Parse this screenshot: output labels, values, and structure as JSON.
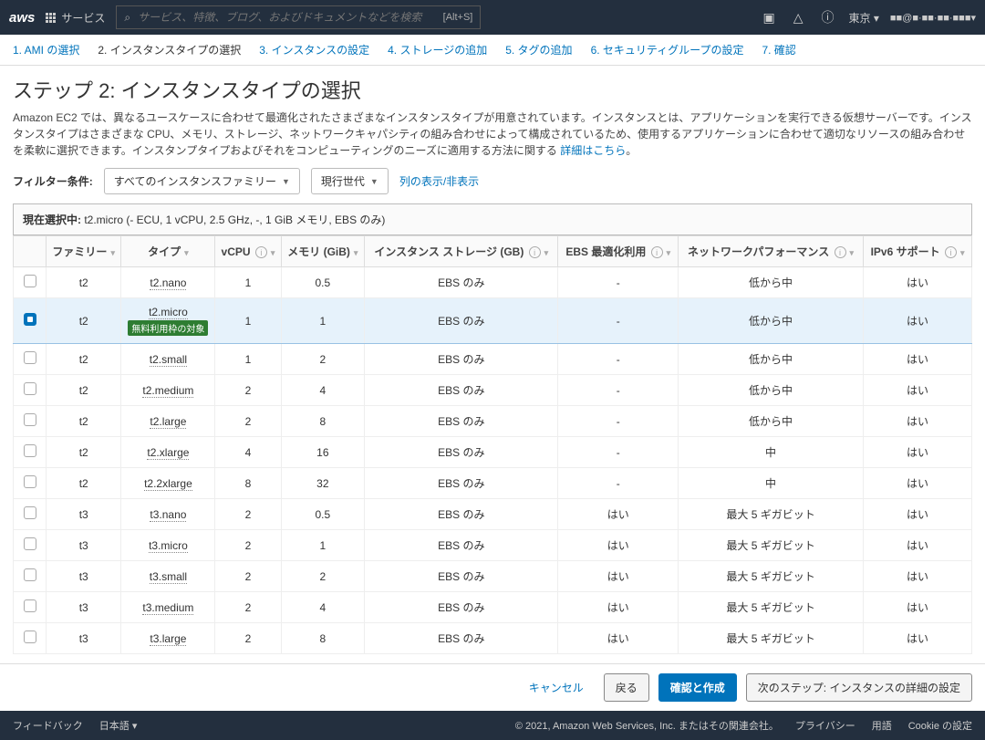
{
  "topbar": {
    "services": "サービス",
    "search_placeholder": "サービス、特徴、ブログ、およびドキュメントなどを検索",
    "search_shortcut": "[Alt+S]",
    "region": "東京 ▾",
    "user": "■■@■·■■·■■·■■■▾"
  },
  "wizard": [
    "1. AMI の選択",
    "2. インスタンスタイプの選択",
    "3. インスタンスの設定",
    "4. ストレージの追加",
    "5. タグの追加",
    "6. セキュリティグループの設定",
    "7. 確認"
  ],
  "heading": "ステップ 2: インスタンスタイプの選択",
  "description": "Amazon EC2 では、異なるユースケースに合わせて最適化されたさまざまなインスタンスタイプが用意されています。インスタンスとは、アプリケーションを実行できる仮想サーバーです。インスタンスタイプはさまざまな CPU、メモリ、ストレージ、ネットワークキャパシティの組み合わせによって構成されているため、使用するアプリケーションに合わせて適切なリソースの組み合わせを柔軟に選択できます。インスタンプタイプおよびそれをコンピューティングのニーズに適用する方法に関する ",
  "desc_link": "詳細はこちら",
  "filter": {
    "label": "フィルター条件:",
    "family": "すべてのインスタンスファミリー",
    "gen": "現行世代",
    "columns_link": "列の表示/非表示"
  },
  "selected_bar": {
    "prefix": "現在選択中: ",
    "text": "t2.micro (- ECU, 1 vCPU, 2.5 GHz, -, 1 GiB メモリ, EBS のみ)"
  },
  "columns": {
    "family": "ファミリー",
    "type": "タイプ",
    "vcpu": "vCPU",
    "memory": "メモリ (GiB)",
    "storage": "インスタンス ストレージ (GB)",
    "ebs": "EBS 最適化利用",
    "network": "ネットワークパフォーマンス",
    "ipv6": "IPv6 サポート"
  },
  "free_tier_label": "無料利用枠の対象",
  "rows": [
    {
      "sel": false,
      "family": "t2",
      "type": "t2.nano",
      "vcpu": "1",
      "mem": "0.5",
      "storage": "EBS のみ",
      "ebs": "-",
      "net": "低から中",
      "ipv6": "はい",
      "free": false
    },
    {
      "sel": true,
      "family": "t2",
      "type": "t2.micro",
      "vcpu": "1",
      "mem": "1",
      "storage": "EBS のみ",
      "ebs": "-",
      "net": "低から中",
      "ipv6": "はい",
      "free": true
    },
    {
      "sel": false,
      "family": "t2",
      "type": "t2.small",
      "vcpu": "1",
      "mem": "2",
      "storage": "EBS のみ",
      "ebs": "-",
      "net": "低から中",
      "ipv6": "はい",
      "free": false
    },
    {
      "sel": false,
      "family": "t2",
      "type": "t2.medium",
      "vcpu": "2",
      "mem": "4",
      "storage": "EBS のみ",
      "ebs": "-",
      "net": "低から中",
      "ipv6": "はい",
      "free": false
    },
    {
      "sel": false,
      "family": "t2",
      "type": "t2.large",
      "vcpu": "2",
      "mem": "8",
      "storage": "EBS のみ",
      "ebs": "-",
      "net": "低から中",
      "ipv6": "はい",
      "free": false
    },
    {
      "sel": false,
      "family": "t2",
      "type": "t2.xlarge",
      "vcpu": "4",
      "mem": "16",
      "storage": "EBS のみ",
      "ebs": "-",
      "net": "中",
      "ipv6": "はい",
      "free": false
    },
    {
      "sel": false,
      "family": "t2",
      "type": "t2.2xlarge",
      "vcpu": "8",
      "mem": "32",
      "storage": "EBS のみ",
      "ebs": "-",
      "net": "中",
      "ipv6": "はい",
      "free": false
    },
    {
      "sel": false,
      "family": "t3",
      "type": "t3.nano",
      "vcpu": "2",
      "mem": "0.5",
      "storage": "EBS のみ",
      "ebs": "はい",
      "net": "最大 5 ギガビット",
      "ipv6": "はい",
      "free": false
    },
    {
      "sel": false,
      "family": "t3",
      "type": "t3.micro",
      "vcpu": "2",
      "mem": "1",
      "storage": "EBS のみ",
      "ebs": "はい",
      "net": "最大 5 ギガビット",
      "ipv6": "はい",
      "free": false
    },
    {
      "sel": false,
      "family": "t3",
      "type": "t3.small",
      "vcpu": "2",
      "mem": "2",
      "storage": "EBS のみ",
      "ebs": "はい",
      "net": "最大 5 ギガビット",
      "ipv6": "はい",
      "free": false
    },
    {
      "sel": false,
      "family": "t3",
      "type": "t3.medium",
      "vcpu": "2",
      "mem": "4",
      "storage": "EBS のみ",
      "ebs": "はい",
      "net": "最大 5 ギガビット",
      "ipv6": "はい",
      "free": false
    },
    {
      "sel": false,
      "family": "t3",
      "type": "t3.large",
      "vcpu": "2",
      "mem": "8",
      "storage": "EBS のみ",
      "ebs": "はい",
      "net": "最大 5 ギガビット",
      "ipv6": "はい",
      "free": false
    }
  ],
  "actions": {
    "cancel": "キャンセル",
    "back": "戻る",
    "review": "確認と作成",
    "next": "次のステップ: インスタンスの詳細の設定"
  },
  "footer": {
    "feedback": "フィードバック",
    "lang": "日本語 ▾",
    "copyright": "© 2021, Amazon Web Services, Inc. またはその関連会社。",
    "privacy": "プライバシー",
    "terms": "用語",
    "cookies": "Cookie の設定"
  }
}
